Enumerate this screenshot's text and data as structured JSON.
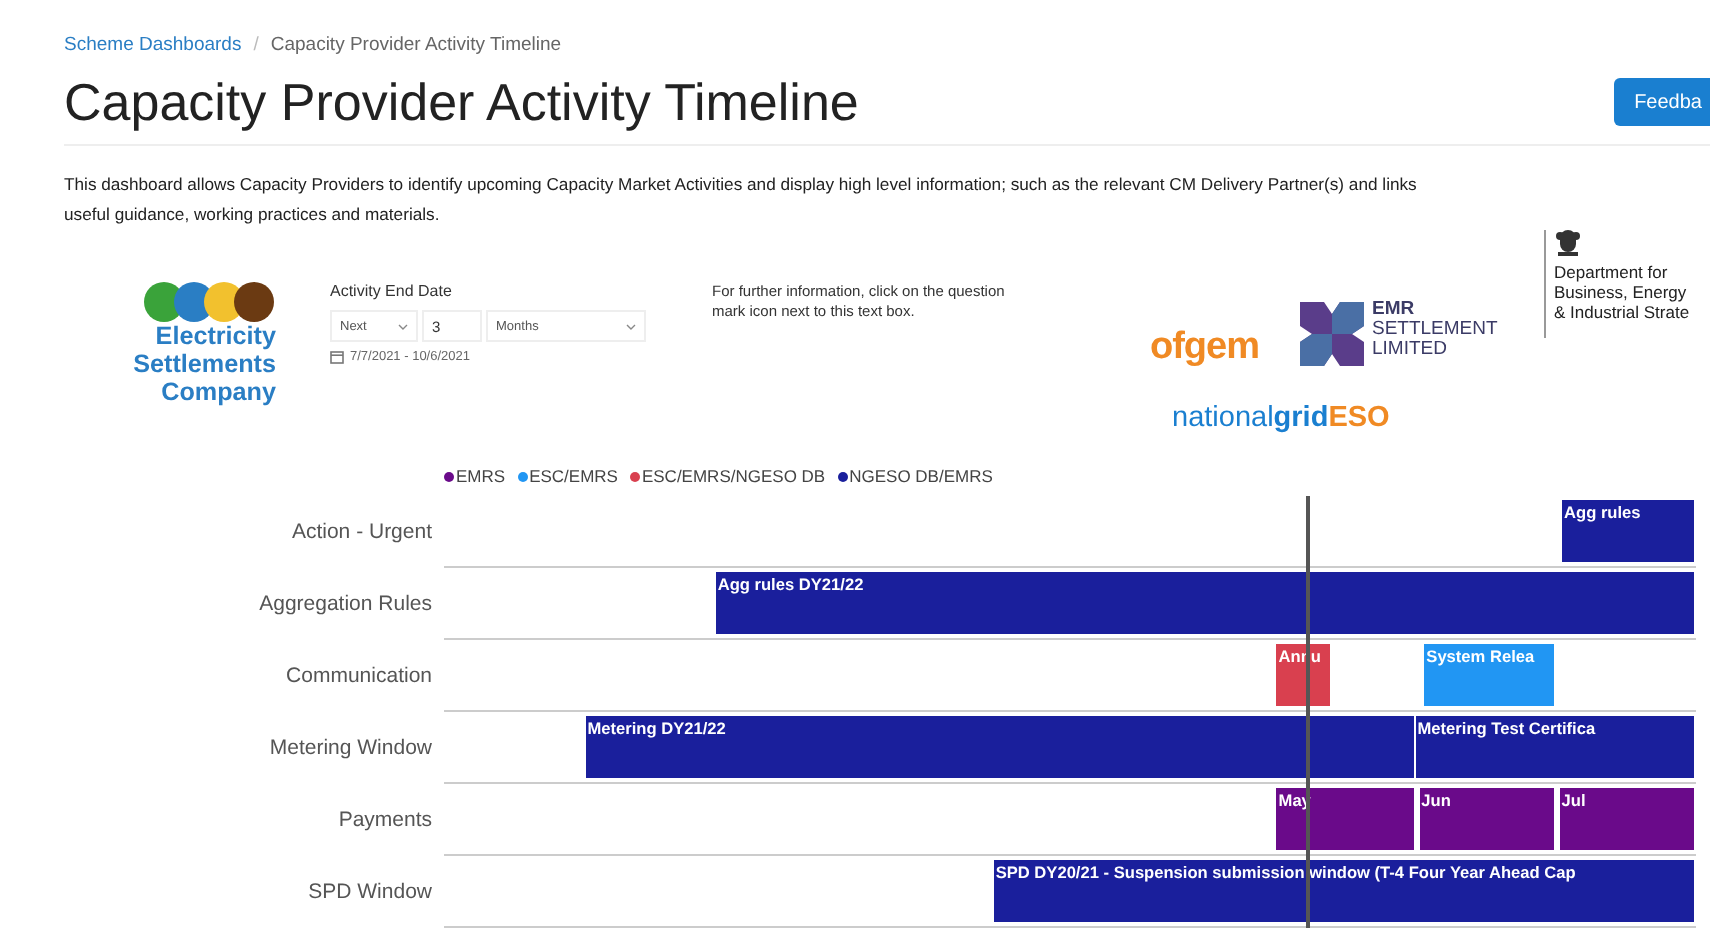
{
  "breadcrumb": [
    {
      "label": "Scheme Dashboards",
      "kind": "link"
    },
    {
      "label": "Capacity Provider Activity Timeline",
      "kind": "current"
    }
  ],
  "title": "Capacity Provider Activity Timeline",
  "breadcrumb_separator": "/",
  "feedback_button": "Feedba",
  "description": [
    "This dashboard allows Capacity Providers to identify upcoming Capacity Market Activities and display high level information; such as the relevant CM Delivery Partner(s) and links",
    "useful guidance, working practices and materials."
  ],
  "esc_logo": {
    "lines": [
      "Electricity",
      "Settlements",
      "Company"
    ]
  },
  "filter": {
    "label": "Activity End Date",
    "period": "Next",
    "count": "3",
    "unit": "Months",
    "range": "7/7/2021 - 10/6/2021"
  },
  "info_text": "For further information, click on the question mark icon next to this text box.",
  "partner_logos": {
    "ofgem": "ofgem",
    "emr": [
      "EMR",
      "SETTLEMENT",
      "LIMITED"
    ],
    "national_grid": [
      "national",
      "grid",
      "ESO"
    ],
    "department": [
      "Department for",
      "Business, Energy",
      "& Industrial Strate"
    ]
  },
  "legend": [
    {
      "label": "EMRS",
      "color": "#6a0a8a"
    },
    {
      "label": "ESC/EMRS",
      "color": "#2196f3"
    },
    {
      "label": "ESC/EMRS/NGESO DB",
      "color": "#d9404f"
    },
    {
      "label": "NGESO DB/EMRS",
      "color": "#1a1f9c"
    }
  ],
  "rows": [
    {
      "label": "Action - Urgent",
      "bars": [
        {
          "text": "Agg rules",
          "color": "#1a1f9c"
        }
      ]
    },
    {
      "label": "Aggregation Rules",
      "bars": [
        {
          "text": "Agg rules DY21/22",
          "color": "#1a1f9c"
        }
      ]
    },
    {
      "label": "Communication",
      "bars": [
        {
          "text": "Annu",
          "color": "#d9404f"
        },
        {
          "text": "System Relea",
          "color": "#2196f3"
        }
      ]
    },
    {
      "label": "Metering Window",
      "bars": [
        {
          "text": "Metering DY21/22",
          "color": "#1a1f9c"
        },
        {
          "text": "Metering Test Certifica",
          "color": "#1a1f9c"
        }
      ]
    },
    {
      "label": "Payments",
      "bars": [
        {
          "text": "May",
          "color": "#6a0a8a"
        },
        {
          "text": "Jun",
          "color": "#6a0a8a"
        },
        {
          "text": "Jul",
          "color": "#6a0a8a"
        }
      ]
    },
    {
      "label": "SPD Window",
      "bars": [
        {
          "text": "SPD DY20/21 - Suspension submission window (T-4 Four Year Ahead Cap",
          "color": "#1a1f9c"
        }
      ]
    }
  ]
}
